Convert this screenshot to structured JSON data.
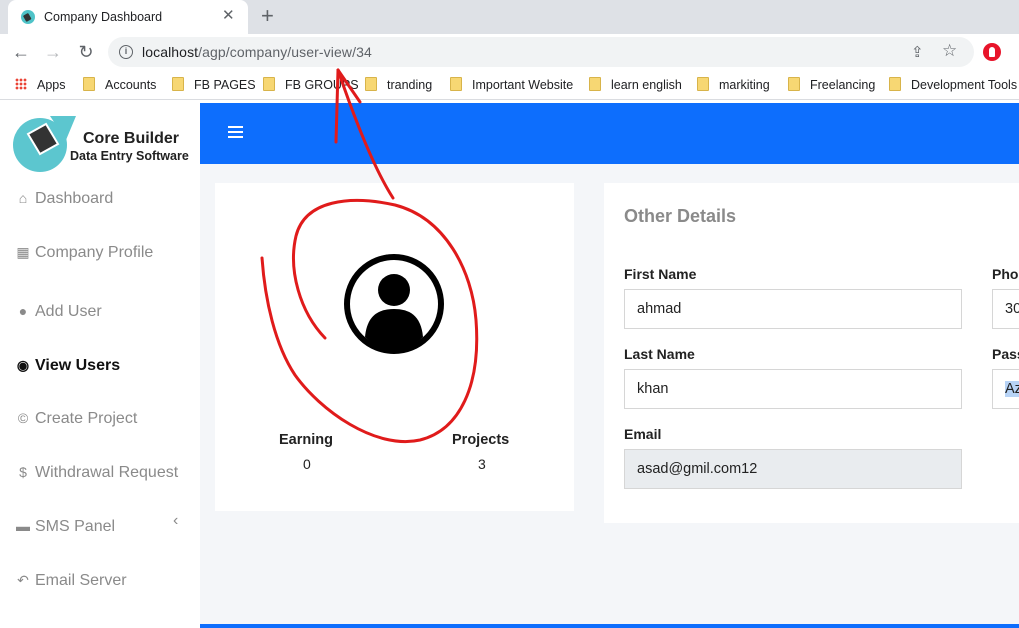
{
  "browser": {
    "tab_title": "Company Dashboard",
    "tab_close": "✕",
    "new_tab": "+",
    "url_host": "localhost",
    "url_path": "/agp/company/user-view/34",
    "bookmarks": [
      {
        "label": "Apps",
        "icon": "apps-icon"
      },
      {
        "label": "Accounts",
        "icon": "folder-icon"
      },
      {
        "label": "FB PAGES",
        "icon": "folder-icon"
      },
      {
        "label": "FB GROUPS",
        "icon": "folder-icon"
      },
      {
        "label": "tranding",
        "icon": "folder-icon"
      },
      {
        "label": "Important Website",
        "icon": "folder-icon"
      },
      {
        "label": "learn english",
        "icon": "folder-icon"
      },
      {
        "label": "markiting",
        "icon": "folder-icon"
      },
      {
        "label": "Freelancing",
        "icon": "folder-icon"
      },
      {
        "label": "Development Tools",
        "icon": "folder-icon"
      }
    ]
  },
  "brand": {
    "name": "Core Builder",
    "tagline": "Data Entry Software"
  },
  "sidebar": {
    "items": [
      {
        "label": "Dashboard",
        "icon": "home-icon"
      },
      {
        "label": "Company Profile",
        "icon": "building-icon"
      },
      {
        "label": "Add User",
        "icon": "user-icon"
      },
      {
        "label": "View Users",
        "icon": "eye-icon",
        "active": true
      },
      {
        "label": "Create Project",
        "icon": "cc-icon"
      },
      {
        "label": "Withdrawal Request",
        "icon": "dollar-icon"
      },
      {
        "label": "SMS Panel",
        "icon": "comment-icon"
      },
      {
        "label": "Email Server",
        "icon": "reply-icon"
      }
    ]
  },
  "profile_card": {
    "earning_label": "Earning",
    "earning_value": "0",
    "projects_label": "Projects",
    "projects_value": "3"
  },
  "details": {
    "title": "Other Details",
    "first_name_label": "First Name",
    "first_name_value": "ahmad",
    "last_name_label": "Last Name",
    "last_name_value": "khan",
    "email_label": "Email",
    "email_value": "asad@gmil.com12",
    "phone_label": "Pho",
    "phone_value": "30",
    "password_label": "Pass",
    "password_value": "Az"
  },
  "colors": {
    "primary": "#0d6efd",
    "annotation": "#e01b1b"
  }
}
